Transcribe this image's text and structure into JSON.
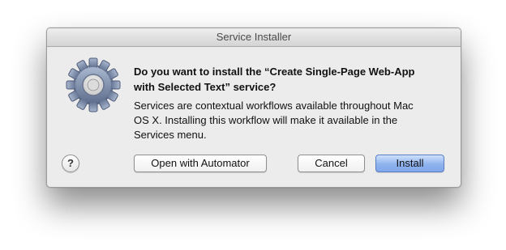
{
  "window": {
    "title": "Service Installer"
  },
  "dialog": {
    "icon": "gear-icon",
    "heading_line1": "Do you want to install the “Create Single-Page Web-App",
    "heading_line2": "with Selected Text” service?",
    "body_line1": "Services are contextual workflows available throughout Mac",
    "body_line2": "OS X. Installing this workflow will make it available in the",
    "body_line3": "Services menu."
  },
  "buttons": {
    "help_label": "?",
    "automator_label": "Open with Automator",
    "cancel_label": "Cancel",
    "install_label": "Install"
  },
  "colors": {
    "window_bg": "#ececec",
    "default_button": "#8fb3ee"
  }
}
